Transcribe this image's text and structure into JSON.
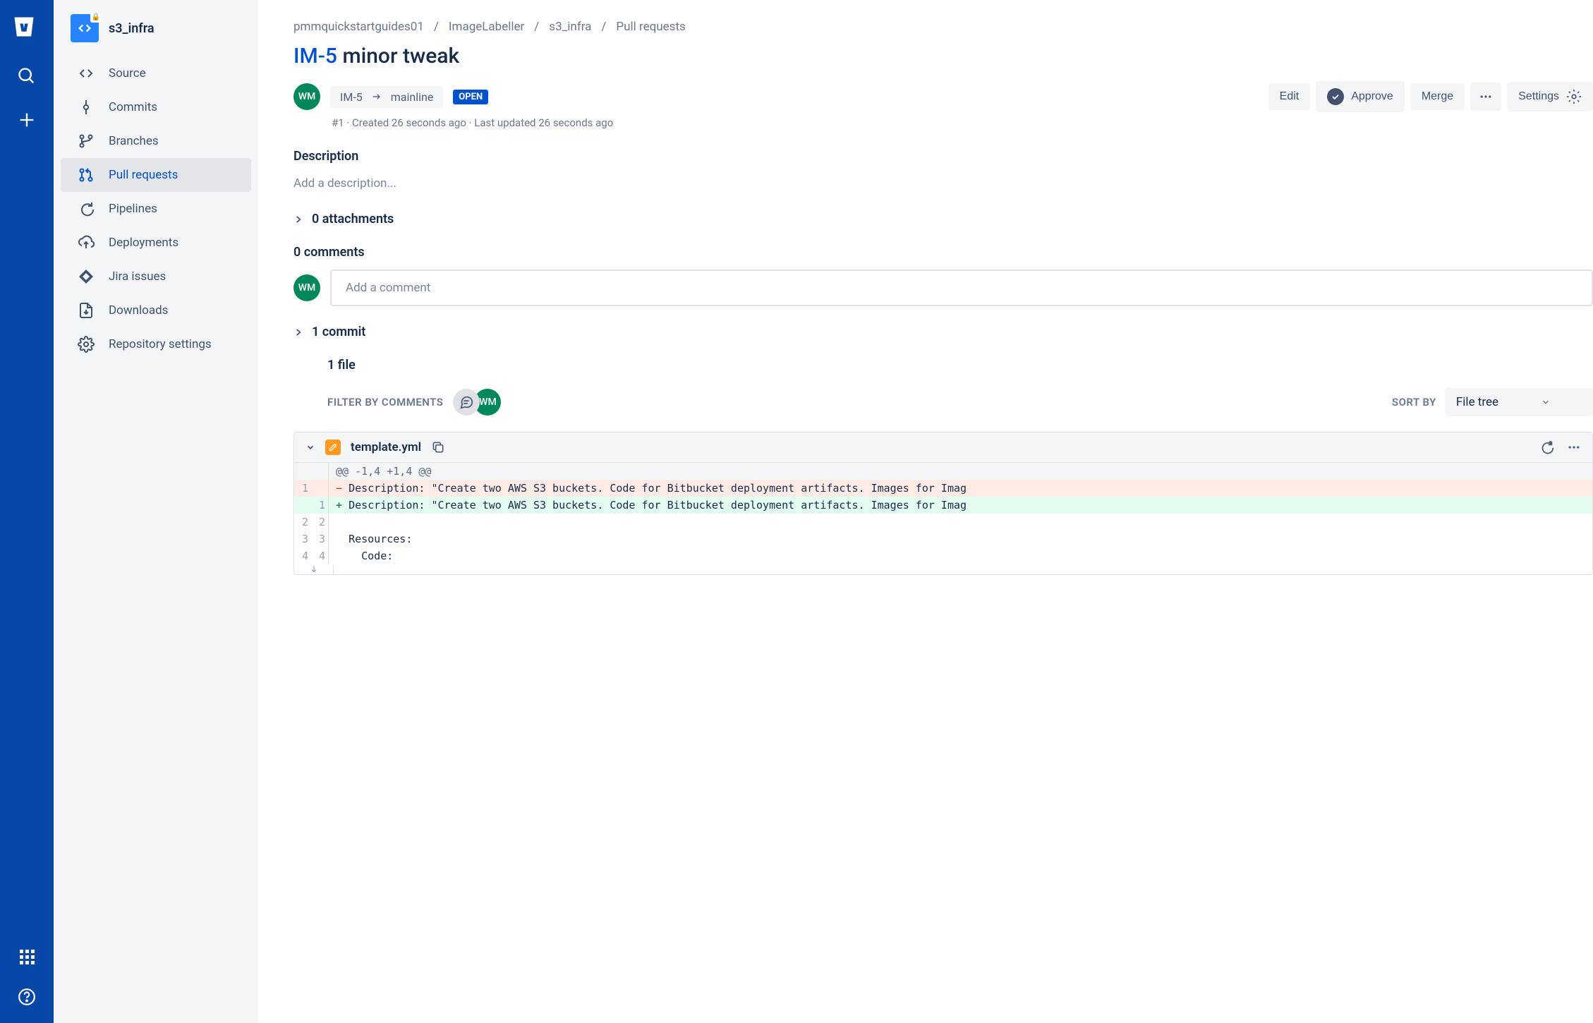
{
  "repo": {
    "name": "s3_infra",
    "avatar_initials": "</>"
  },
  "rail": {
    "product": "Bitbucket"
  },
  "sidebar": {
    "items": [
      {
        "label": "Source"
      },
      {
        "label": "Commits"
      },
      {
        "label": "Branches"
      },
      {
        "label": "Pull requests"
      },
      {
        "label": "Pipelines"
      },
      {
        "label": "Deployments"
      },
      {
        "label": "Jira issues"
      },
      {
        "label": "Downloads"
      },
      {
        "label": "Repository settings"
      }
    ]
  },
  "breadcrumb": [
    "pmmquickstartguides01",
    "ImageLabeller",
    "s3_infra",
    "Pull requests"
  ],
  "pr": {
    "issue_key": "IM-5",
    "title_rest": " minor tweak",
    "source_branch": "IM-5",
    "target_branch": "mainline",
    "status": "OPEN",
    "id_created": "#1 · Created 26 seconds ago · Last updated 26 seconds ago",
    "author_initials": "WM"
  },
  "actions": {
    "edit": "Edit",
    "approve": "Approve",
    "merge": "Merge",
    "settings": "Settings"
  },
  "description": {
    "heading": "Description",
    "placeholder": "Add a description..."
  },
  "attachments": {
    "heading": "0 attachments"
  },
  "comments": {
    "heading": "0 comments",
    "placeholder": "Add a comment",
    "user_initials": "WM"
  },
  "commits": {
    "heading": "1 commit"
  },
  "files": {
    "heading": "1 file",
    "filter_label": "FILTER BY COMMENTS",
    "sort_label": "SORT BY",
    "sort_value": "File tree",
    "reviewer_initials": "WM"
  },
  "diff": {
    "filename": "template.yml",
    "hunk": "@@ -1,4 +1,4 @@",
    "lines": [
      {
        "type": "del",
        "ol": "1",
        "nl": "",
        "text": "Description: \"Create two AWS S3 buckets. Code for Bitbucket deployment artifacts. Images for Imag"
      },
      {
        "type": "add",
        "ol": "",
        "nl": "1",
        "text": "Description: \"Create two AWS S3 buckets. Code for Bitbucket deployment artifacts. Images for Imag"
      },
      {
        "type": "ctx",
        "ol": "2",
        "nl": "2",
        "text": ""
      },
      {
        "type": "ctx",
        "ol": "3",
        "nl": "3",
        "text": "Resources:"
      },
      {
        "type": "ctx",
        "ol": "4",
        "nl": "4",
        "text": "  Code:"
      }
    ]
  }
}
